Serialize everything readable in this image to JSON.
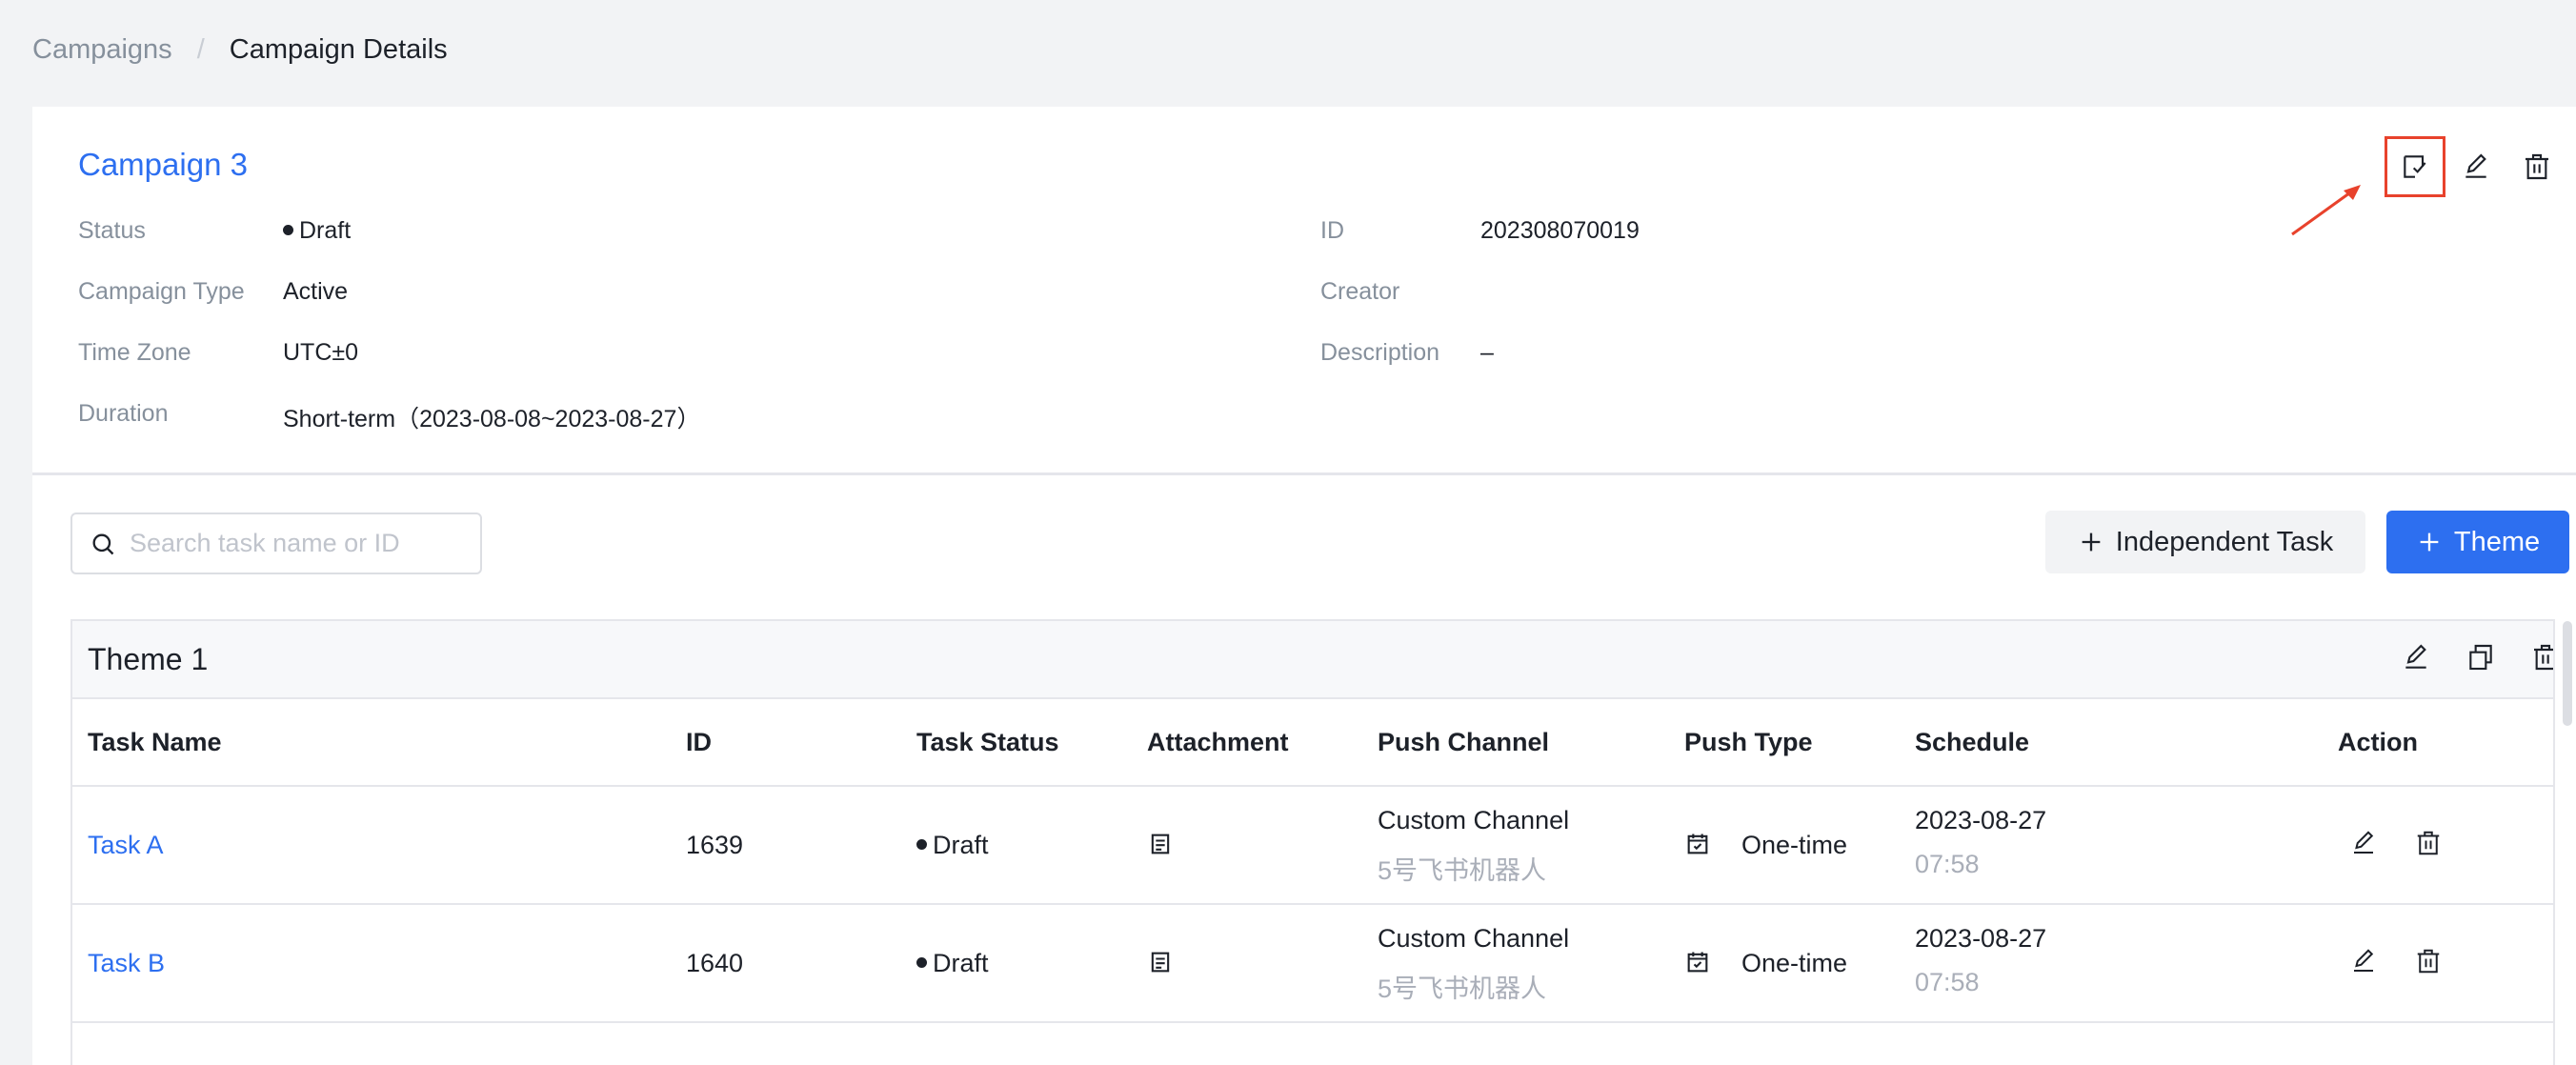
{
  "breadcrumb": {
    "parent": "Campaigns",
    "separator": "/",
    "current": "Campaign Details"
  },
  "campaign": {
    "title": "Campaign 3",
    "fields_left": [
      {
        "label": "Status",
        "value": "Draft"
      },
      {
        "label": "Campaign Type",
        "value": "Active"
      },
      {
        "label": "Time Zone",
        "value": "UTC±0"
      },
      {
        "label": "Duration",
        "value": "Short-term（2023-08-08~2023-08-27）"
      }
    ],
    "fields_right": [
      {
        "label": "ID",
        "value": "202308070019"
      },
      {
        "label": "Creator",
        "value": ""
      },
      {
        "label": "Description",
        "value": "–"
      }
    ],
    "header_icons": [
      "submit-check-icon",
      "edit-icon",
      "delete-icon"
    ]
  },
  "toolbar": {
    "search_placeholder": "Search task name or ID",
    "independent_task_label": "Independent Task",
    "theme_label": "Theme"
  },
  "theme": {
    "title": "Theme 1",
    "action_icons": [
      "edit-icon",
      "copy-icon",
      "delete-icon"
    ],
    "columns": [
      "Task Name",
      "ID",
      "Task Status",
      "Attachment",
      "Push Channel",
      "Push Type",
      "Schedule",
      "Action"
    ],
    "rows": [
      {
        "name": "Task A",
        "id": "1639",
        "status": "Draft",
        "attachment_icon": "document-icon",
        "channel": "Custom Channel",
        "channel_sub": "5号飞书机器人",
        "push_type": "One-time",
        "schedule_date": "2023-08-27",
        "schedule_time": "07:58"
      },
      {
        "name": "Task B",
        "id": "1640",
        "status": "Draft",
        "attachment_icon": "document-icon",
        "channel": "Custom Channel",
        "channel_sub": "5号飞书机器人",
        "push_type": "One-time",
        "schedule_date": "2023-08-27",
        "schedule_time": "07:58"
      }
    ]
  },
  "colors": {
    "accent": "#2d6ff0",
    "highlight": "#e8422c",
    "muted": "#86909c"
  }
}
